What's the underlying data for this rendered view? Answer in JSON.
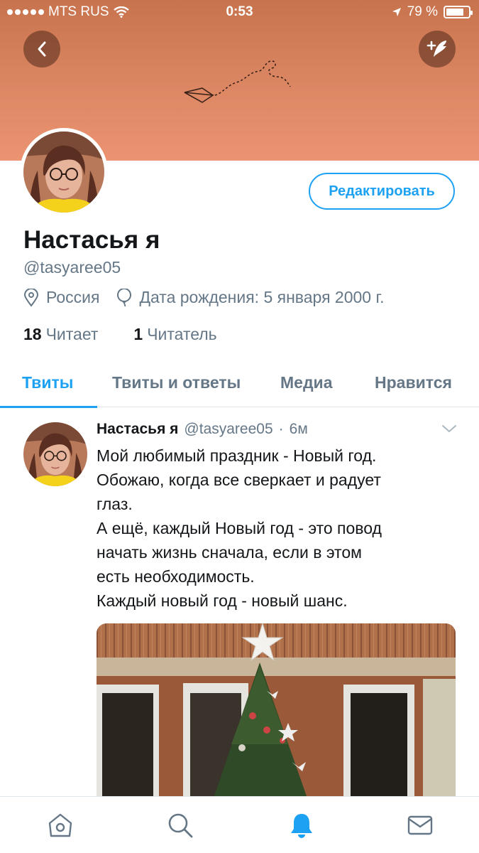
{
  "status_bar": {
    "carrier": "MTS RUS",
    "time": "0:53",
    "battery_text": "79 %",
    "battery_level": 0.79
  },
  "profile": {
    "name": "Настасья я",
    "handle": "@tasyaree05",
    "location": "Россия",
    "birthday": "Дата рождения: 5 января 2000 г.",
    "following_count": "18",
    "following_label": "Читает",
    "followers_count": "1",
    "followers_label": "Читатель",
    "edit_label": "Редактировать"
  },
  "tabs": [
    {
      "label": "Твиты",
      "active": true
    },
    {
      "label": "Твиты и ответы",
      "active": false
    },
    {
      "label": "Медиа",
      "active": false
    },
    {
      "label": "Нравится",
      "active": false
    }
  ],
  "tweet": {
    "author": "Настасья я",
    "handle": "@tasyaree05",
    "dot": "·",
    "time": "6м",
    "lines": [
      "Мой любимый праздник - Новый год.",
      "Обожаю, когда все сверкает и радует",
      "глаз.",
      "А ещё, каждый Новый год - это повод",
      "начать жизнь сначала, если в этом",
      "есть необходимость.",
      "Каждый новый год - новый шанс."
    ]
  },
  "colors": {
    "accent": "#1da1f2",
    "header_top": "#c7734d",
    "header_bottom": "#ec9372",
    "secondary_text": "#657786"
  },
  "icons": {
    "back": "chevron-left-icon",
    "compose": "feather-plus-icon",
    "location": "location-pin-icon",
    "birthday": "balloon-icon",
    "home": "home-icon",
    "search": "search-icon",
    "notifications": "bell-icon",
    "messages": "mail-icon"
  }
}
